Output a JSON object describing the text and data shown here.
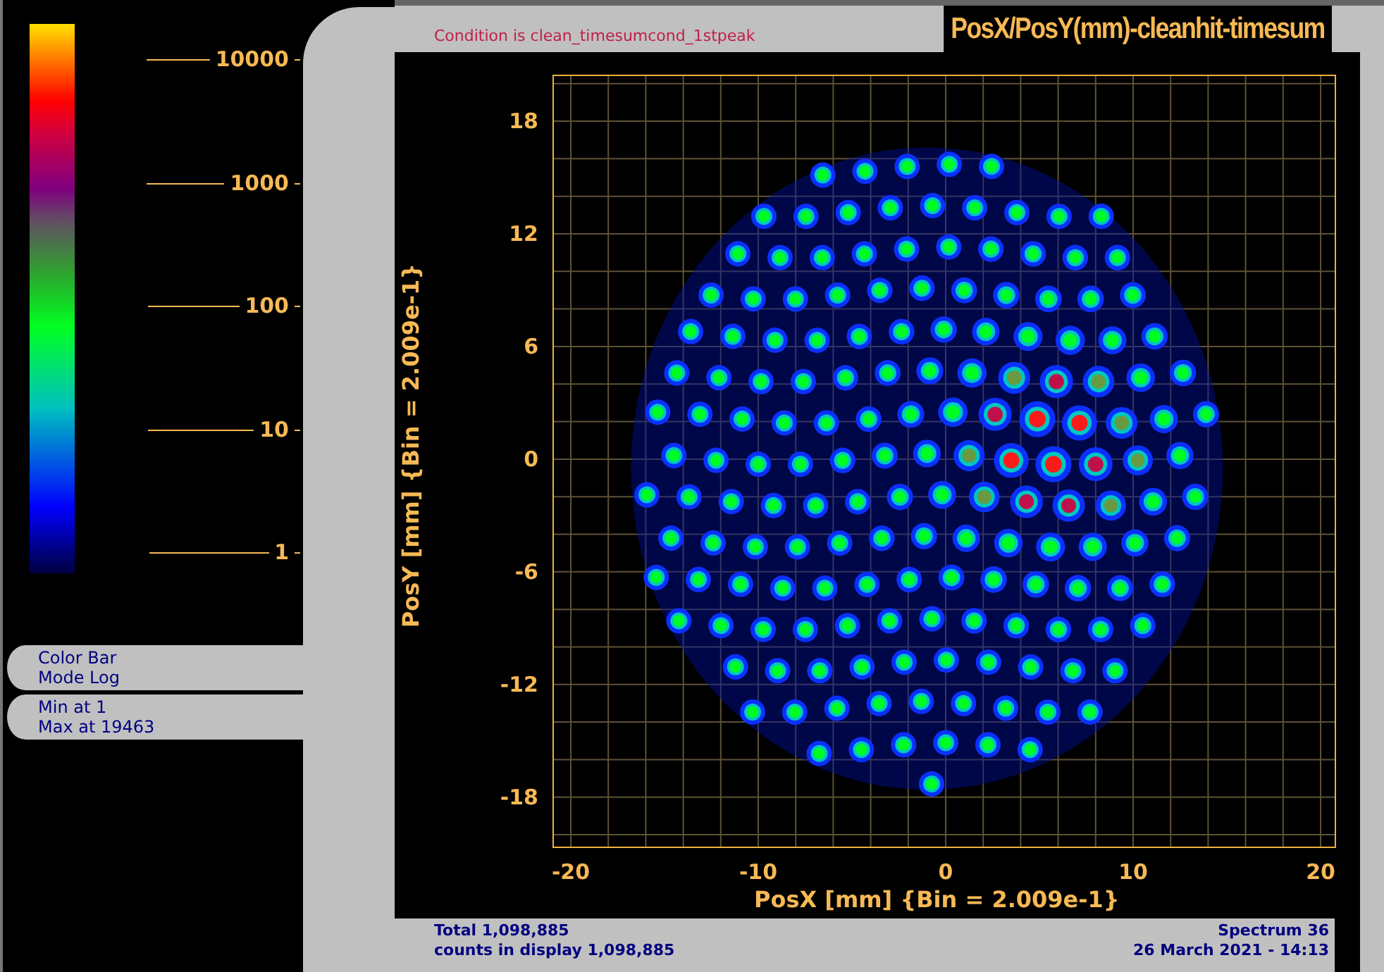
{
  "condition": "Condition is clean_timesumcond_1stpeak",
  "title": "PosX/PosY(mm)-cleanhit-timesum",
  "colorbar": {
    "ticks": [
      "10000",
      "1000",
      "100",
      "10",
      "1"
    ]
  },
  "info_boxes": [
    {
      "lines": [
        "Color Bar",
        "Mode Log"
      ]
    },
    {
      "lines": [
        "Min at 1",
        "Max at 19463"
      ]
    }
  ],
  "plot": {
    "xticks": [
      "-20",
      "-10",
      "0",
      "10",
      "20"
    ],
    "yticks": [
      "18",
      "12",
      "6",
      "0",
      "-6",
      "-12",
      "-18"
    ],
    "xlabel": "PosX [mm] {Bin = 2.009e-1}",
    "ylabel": "PosY [mm] {Bin = 2.009e-1}"
  },
  "footer": {
    "left": [
      "Total 1,098,885",
      "counts in display 1,098,885"
    ],
    "right": [
      "Spectrum 36",
      "26 March 2021 - 14:13"
    ]
  }
}
